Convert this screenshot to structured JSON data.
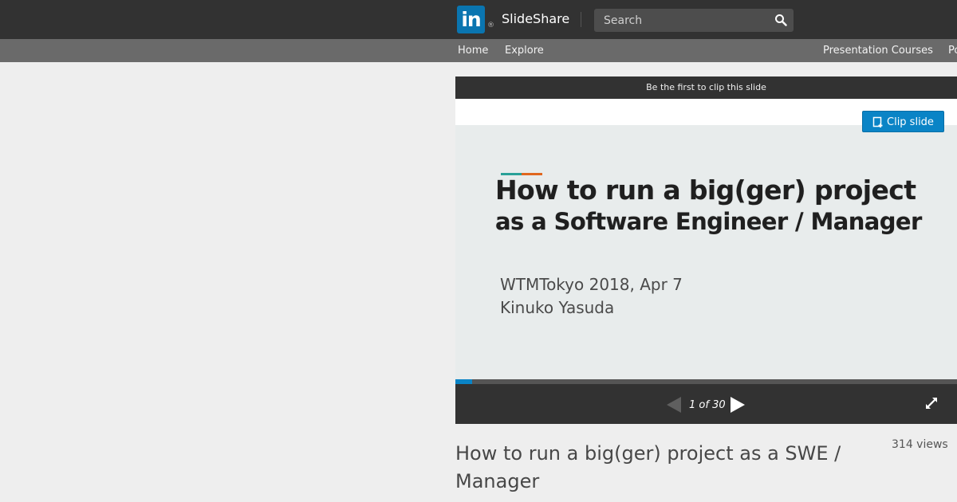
{
  "header": {
    "logo_text": "in",
    "logo_registered": "®",
    "brand": "SlideShare",
    "search_placeholder": "Search"
  },
  "nav": {
    "home": "Home",
    "explore": "Explore",
    "presentation_courses": "Presentation Courses",
    "cut_item": "Po"
  },
  "player": {
    "clip_banner": "Be the first to clip this slide",
    "clip_button": "Clip slide",
    "slide": {
      "title_line1": "How to run a big(ger) project",
      "title_line2": "as a Software Engineer / Manager",
      "event": "WTMTokyo 2018, Apr 7",
      "author": "Kinuko Yasuda",
      "accent_colors": [
        "#2aa198",
        "#e0671f"
      ]
    },
    "counter": "1 of 30",
    "progress_fraction": 0.0333
  },
  "presentation": {
    "title": "How to run a big(ger) project as a SWE / Manager",
    "views": "314 views"
  },
  "colors": {
    "topbar": "#323232",
    "subnav": "#6a6a6a",
    "linkedin_blue": "#0a75b0",
    "clip_button": "#0a84c6"
  }
}
